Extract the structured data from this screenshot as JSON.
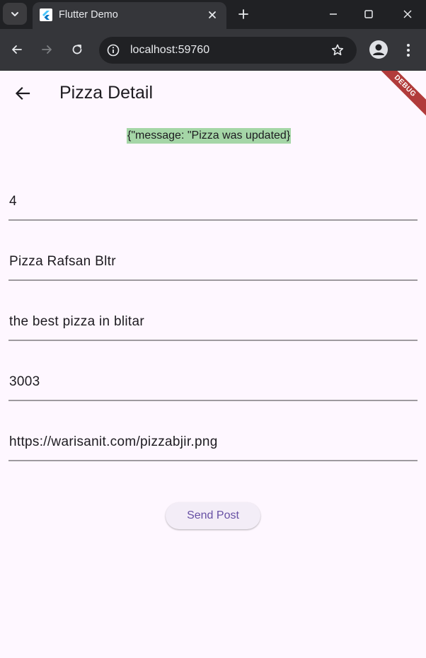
{
  "browser": {
    "tab_title": "Flutter Demo",
    "url": "localhost:59760"
  },
  "app": {
    "title": "Pizza Detail",
    "debug_banner": "DEBUG",
    "message": "{\"message: \"Pizza was updated}",
    "fields": [
      {
        "value": "4"
      },
      {
        "value": "Pizza Rafsan Bltr"
      },
      {
        "value": "the best pizza in blitar"
      },
      {
        "value": "3003"
      },
      {
        "value": "https://warisanit.com/pizzabjir.png"
      }
    ],
    "send_button_label": "Send Post"
  },
  "colors": {
    "tabstrip": "#202124",
    "toolbar": "#35363a",
    "app_background": "#fef7ff",
    "message_highlight": "#a5d6a7",
    "button_text": "#6750a4",
    "debug_banner": "#b13b3b"
  }
}
